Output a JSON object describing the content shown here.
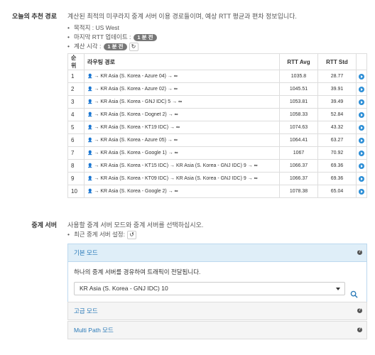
{
  "recommended": {
    "label": "오늘의 추천 경로",
    "description": "계산된 최적의 미쿠라지 중계 서버 이용 경로들이며, 예상 RTT 평균과 편차 정보입니다.",
    "destination": "목적지 : US West",
    "last_update_label": "마지막 RTT 업데이트 :",
    "last_update_badge": "1 분 전",
    "calc_time_label": "계산 시각 :",
    "calc_time_badge": "1 분 전",
    "table": {
      "headers": [
        "순위",
        "라우팅 경로",
        "RTT Avg",
        "RTT Std"
      ],
      "rows": [
        {
          "rank": "1",
          "route": "KR Asia (S. Korea - Azure 04)",
          "avg": "1035.8",
          "std": "28.77"
        },
        {
          "rank": "2",
          "route": "KR Asia (S. Korea - Azure 02)",
          "avg": "1045.51",
          "std": "39.91"
        },
        {
          "rank": "3",
          "route": "KR Asia (S. Korea - GNJ IDC) 5",
          "avg": "1053.81",
          "std": "39.49"
        },
        {
          "rank": "4",
          "route": "KR Asia (S. Korea - Dognet 2)",
          "avg": "1058.33",
          "std": "52.84"
        },
        {
          "rank": "5",
          "route": "KR Asia (S. Korea - KT19 IDC)",
          "avg": "1074.63",
          "std": "43.32"
        },
        {
          "rank": "6",
          "route": "KR Asia (S. Korea - Azure 05)",
          "avg": "1064.41",
          "std": "63.27"
        },
        {
          "rank": "7",
          "route": "KR Asia (S. Korea - Google 1)",
          "avg": "1067",
          "std": "70.92"
        },
        {
          "rank": "8",
          "route": "KR Asia (S. Korea - KT15 IDC) → KR Asia (S. Korea - GNJ IDC) 9",
          "avg": "1066.37",
          "std": "69.36"
        },
        {
          "rank": "9",
          "route": "KR Asia (S. Korea - KT09 IDC) → KR Asia (S. Korea - GNJ IDC) 9",
          "avg": "1066.37",
          "std": "69.36"
        },
        {
          "rank": "10",
          "route": "KR Asia (S. Korea - Google 2)",
          "avg": "1078.38",
          "std": "65.04"
        }
      ]
    }
  },
  "relay": {
    "label": "중계 서버",
    "description": "사용할 중계 서버 모드와 중계 서버를 선택하십시오.",
    "recent_label": "최근 중계 서버 설정:",
    "basic_mode": {
      "title": "기본 모드",
      "body": "하나의 중계 서버를 경유하여 트래픽이 전달됩니다.",
      "selected_server": "KR Asia (S. Korea - GNJ IDC) 10"
    },
    "advanced_mode": {
      "title": "고급 모드"
    },
    "multipath_mode": {
      "title": "Multi Path 모드"
    }
  },
  "colors": {
    "accent": "#2a7ab8",
    "play": "#2e8fd6",
    "badge": "#777777"
  }
}
